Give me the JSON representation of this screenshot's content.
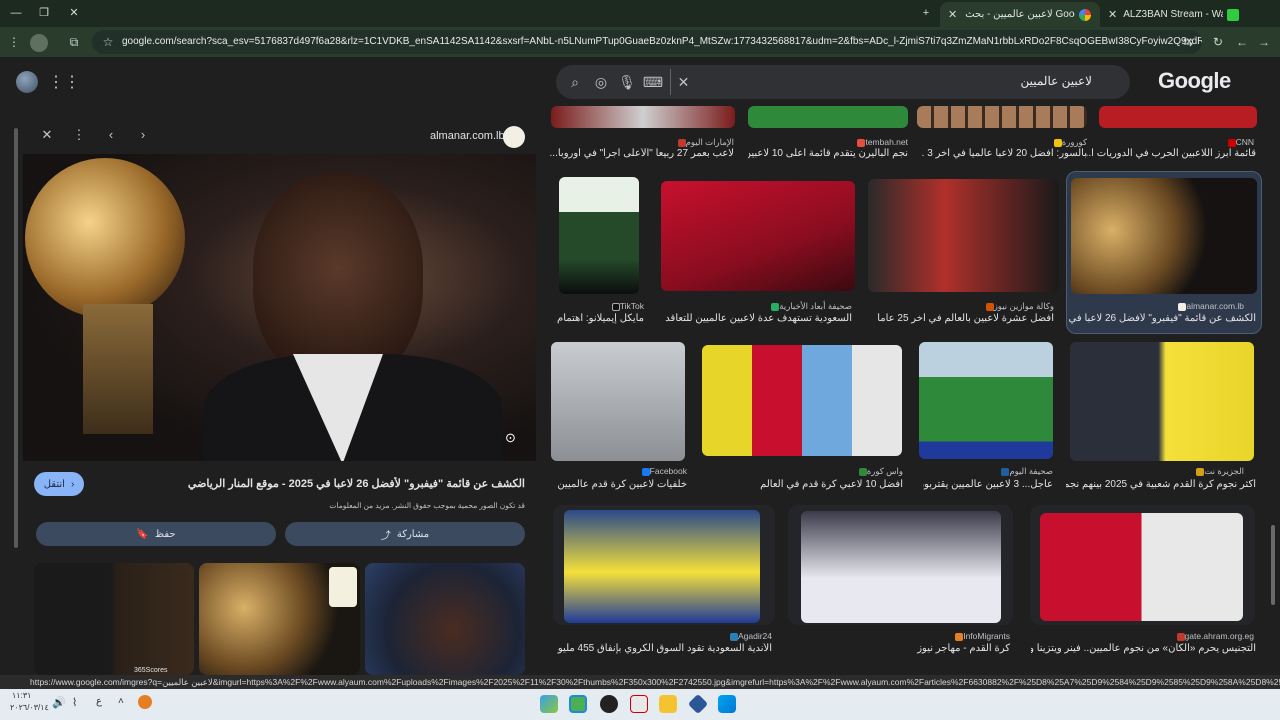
{
  "tabs": [
    {
      "title": "ALZ3BAN Stream - Watch Live Stream...",
      "active": false
    },
    {
      "title": "لاعبين عالميين - بحث Google",
      "active": true
    }
  ],
  "url": "google.com/search?sca_esv=5176837d497f6a28&rlz=1C1VDKB_enSA1142SA1142&sxsrf=ANbL-n5LNumPTup0GuaeBz0zknP4_MtSZw:1773432568817&udm=2&fbs=ADc_l-ZjmiS7ti7q3ZmZMaN1rbbLxRDo2F8CsqOGEBwI38CyFoyiw2Q9xdRS3eeSGvl9LCUg...",
  "search": {
    "query": "لاعبين عالميين",
    "logo": "Google"
  },
  "panel": {
    "source": "almanar.com.lb",
    "title": "الكشف عن قائمة \"فيفبرو\" لأفضل 26 لاعبا في 2025 - موقع المنار الرياضي",
    "visit_label": "انتقل",
    "copyright": "قد تكون الصور محمية بموجب حقوق النشر. مزيد من المعلومات",
    "share_label": "مشاركة",
    "save_label": "حفظ",
    "related_label": "365Scores"
  },
  "top_row": [
    {
      "source": "CNN",
      "title": "قائمة أبرز اللاعبين الحرب في الدوريات ا..."
    },
    {
      "source": "كورورة",
      "title": "بالسور: أفضل 20 لاعبا عالميا في آخر 3 ..."
    },
    {
      "source": "tembah.net",
      "title": "نجم الباليرن يتقدم قائمة أعلى 10 لاعبين..."
    },
    {
      "source": "الإمارات اليوم",
      "title": "لاعب بعمر 27 ربيعاً \"الأعلى أجراً\" في أوروبا..."
    }
  ],
  "row2": [
    {
      "source": "almanar.com.lb",
      "title": "الكشف عن قائمة \"فيفبرو\" لأفضل 26 لاعبا في 2..."
    },
    {
      "source": "وكالة موازين نيوز",
      "title": "أفضل عشرة لاعبين بالعالم في آخر 25 عاماً"
    },
    {
      "source": "صحيفة أبعاد الأخبارية",
      "title": "السعودية تستهدف عدة لاعبين عالميين للتعاقد معهم ع..."
    },
    {
      "source": "TikTok",
      "title": "مايكل إيميلانو: اهتمام ع..."
    }
  ],
  "row3": [
    {
      "source": "الجزيرة نت",
      "title": "أكثر نجوم كرة القدم شعبية في 2025 بينهم نجم ع..."
    },
    {
      "source": "صحيفة اليوم",
      "title": "عاجل... 3 لاعبين عالميين يقتربون..."
    },
    {
      "source": "واس كورة",
      "title": "أفضل 10 لاعبي كرة قدم في العالم"
    },
    {
      "source": "Facebook",
      "title": "خلفيات لاعبين كرة قدم عالميين"
    }
  ],
  "row4": [
    {
      "source": "gate.ahram.org.eg",
      "title": "التجنيس يحرم «الكان» من نجوم عالميين.. فينر ويتزينا ورينو..."
    },
    {
      "source": "InfoMigrants",
      "title": "كرة القدم - مهاجر نيوز"
    },
    {
      "source": "Agadir24",
      "title": "الأندية السعودية تقود السوق الكروي بإنفاق 455 مليون دولا..."
    }
  ],
  "status_url": "https://www.google.com/imgres?q=لاعبين عالميين&imgurl=https%3A%2F%2Fwww.alyaum.com%2Fuploads%2Fimages%2F2025%2F11%2F30%2Fthumbs%2F350x300%2F2742550.jpg&imgrefurl=https%3A%2F%2Fwww.alyaum.com%2Farticles%2F6630882%2F%25D8%25A7%25D9%2584%25D9%2585%25D9%258A%25D8%25AF%25D8%25A7%25D9%25...",
  "clock": {
    "time": "١١:٣١",
    "date": "٢٠٢٦/٠٣/١٤"
  },
  "colors": {
    "tab_bar": "#1d2a1f",
    "toolbar": "#2a3c2c",
    "page_bg": "#1f1f1f",
    "accent": "#8ab4f8"
  }
}
